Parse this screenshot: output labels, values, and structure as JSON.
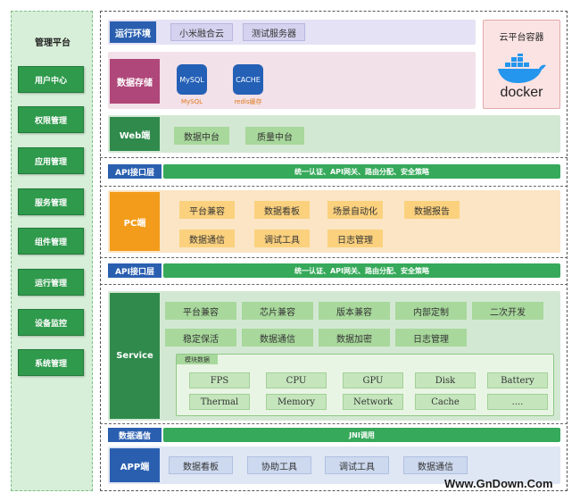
{
  "management": {
    "title": "管理平台",
    "items": [
      "用户中心",
      "权限管理",
      "应用管理",
      "服务管理",
      "组件管理",
      "运行管理",
      "设备监控",
      "系统管理"
    ]
  },
  "runtime": {
    "label": "运行环境",
    "chips": [
      "小米融合云",
      "测试服务器"
    ]
  },
  "cloud": {
    "title": "云平台容器",
    "docker_text": "docker"
  },
  "storage": {
    "label": "数据存储",
    "mysql": {
      "icon_text": "MySQL",
      "caption": "MySQL"
    },
    "cache": {
      "icon_text": "CACHE",
      "caption": "redis缓存"
    }
  },
  "web": {
    "label": "Web端",
    "chips": [
      "数据中台",
      "质量中台"
    ]
  },
  "api1": {
    "label": "API接口层",
    "bar_text": "统一认证、API网关、路由分配、安全策略"
  },
  "pc": {
    "label": "PC端",
    "row1": [
      "平台兼容",
      "数据看板",
      "场景自动化",
      "数据报告"
    ],
    "row2": [
      "数据通信",
      "调试工具",
      "日志管理"
    ]
  },
  "api2": {
    "label": "API接口层",
    "bar_text": "统一认证、API网关、路由分配、安全策略"
  },
  "service": {
    "label": "Service",
    "row1": [
      "平台兼容",
      "芯片兼容",
      "版本兼容",
      "内部定制",
      "二次开发"
    ],
    "row2": [
      "稳定保活",
      "数据通信",
      "数据加密",
      "日志管理"
    ],
    "module_title": "模块数据",
    "modules_row1": [
      "FPS",
      "CPU",
      "GPU",
      "Disk",
      "Battery"
    ],
    "modules_row2": [
      "Thermal",
      "Memory",
      "Network",
      "Cache",
      "...."
    ]
  },
  "comm": {
    "label": "数据通信",
    "bar_text": "JNI调用"
  },
  "app": {
    "label": "APP端",
    "chips": [
      "数据看板",
      "协助工具",
      "调试工具",
      "数据通信"
    ]
  },
  "watermark": "Www.GnDown.Com",
  "colors": {
    "sidebar_bg": "#d7efd8",
    "green_dark": "#2f9a4c",
    "blue_label": "#2a5fb0",
    "pc_orange": "#f39c1b",
    "service_green": "#2f8a4c",
    "docker_blue": "#2496ed"
  }
}
